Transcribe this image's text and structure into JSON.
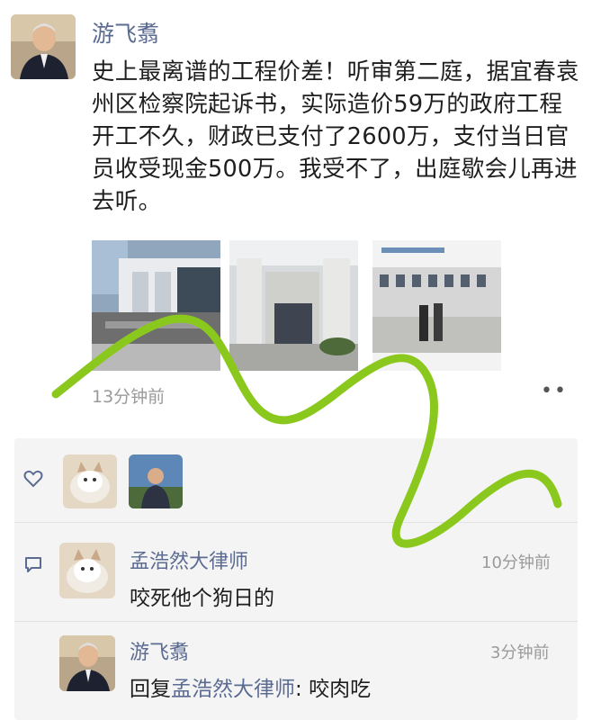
{
  "post": {
    "author": "游飞翥",
    "text": "史上最离谱的工程价差！听审第二庭，据宜春袁州区检察院起诉书，实际造价59万的政府工程开工不久，财政已支付了2600万，支付当日官员收受现金500万。我受不了，出庭歇会儿再进去听。",
    "time": "13分钟前",
    "more_icon": "more-dots-icon",
    "images": [
      "photo-courthouse-entrance",
      "photo-courthouse-facade",
      "photo-people-at-court"
    ]
  },
  "likes": {
    "icon": "heart-icon",
    "avatars": [
      "avatar-cat",
      "avatar-man"
    ]
  },
  "comments": [
    {
      "author": "孟浩然大律师",
      "time": "10分钟前",
      "text": "咬死他个狗日的"
    },
    {
      "author": "游飞翥",
      "time": "3分钟前",
      "reply_prefix": "回复",
      "reply_to": "孟浩然大律师",
      "reply_sep": ": ",
      "text": "咬肉吃"
    }
  ],
  "comment_icon": "comment-icon",
  "colors": {
    "name": "#5b6b92",
    "annotation": "#8bc81e",
    "panel": "#f4f4f4"
  }
}
